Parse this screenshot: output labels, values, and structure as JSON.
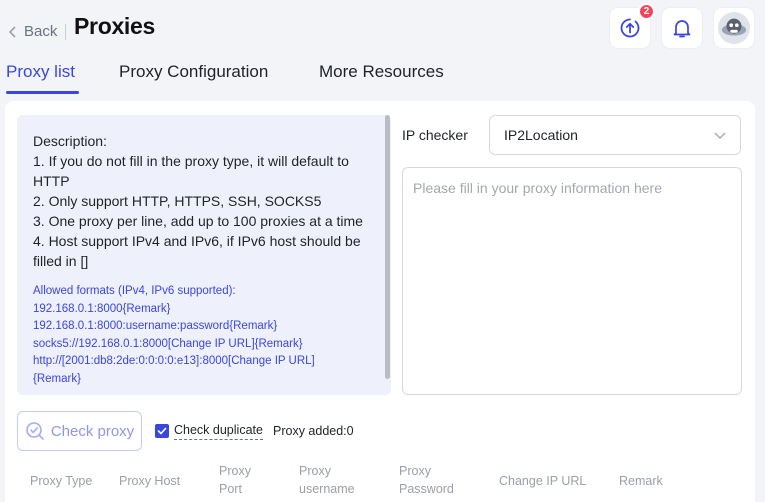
{
  "header": {
    "back_label": "Back",
    "title": "Proxies",
    "update_badge": "2"
  },
  "tabs": [
    {
      "label": "Proxy list",
      "active": true
    },
    {
      "label": "Proxy Configuration",
      "active": false
    },
    {
      "label": "More Resources",
      "active": false
    }
  ],
  "description": {
    "lines": [
      "Description:",
      "1. If you do not fill in the proxy type, it will default to",
      "HTTP",
      "2. Only support HTTP, HTTPS, SSH, SOCKS5",
      "3. One proxy per line, add up to 100 proxies at a time",
      "4. Host support IPv4 and IPv6, if IPv6 host should be",
      "filled in []"
    ],
    "formats": [
      "Allowed formats (IPv4, IPv6 supported):",
      "192.168.0.1:8000{Remark}",
      "192.168.0.1:8000:username:password{Remark}",
      "socks5://192.168.0.1:8000[Change IP URL]{Remark}",
      "http://[2001:db8:2de:0:0:0:0:e13]:8000[Change IP URL]",
      "{Remark}"
    ]
  },
  "ip_checker": {
    "label": "IP checker",
    "selected": "IP2Location"
  },
  "proxy_input": {
    "placeholder": "Please fill in your proxy information here",
    "value": ""
  },
  "actions": {
    "check_proxy_label": "Check proxy",
    "check_duplicate_label": "Check duplicate",
    "check_duplicate_checked": true,
    "proxy_added_label": "Proxy added:",
    "proxy_added_count": "0"
  },
  "table": {
    "headers": [
      [
        "Proxy Type"
      ],
      [
        "Proxy Host"
      ],
      [
        "Proxy",
        "Port"
      ],
      [
        "Proxy",
        "username"
      ],
      [
        "Proxy",
        "Password"
      ],
      [
        "Change IP URL"
      ],
      [
        "Remark"
      ]
    ]
  },
  "colors": {
    "accent": "#3a46e0",
    "badge": "#f5455c",
    "description_bg": "#eef0fb"
  }
}
